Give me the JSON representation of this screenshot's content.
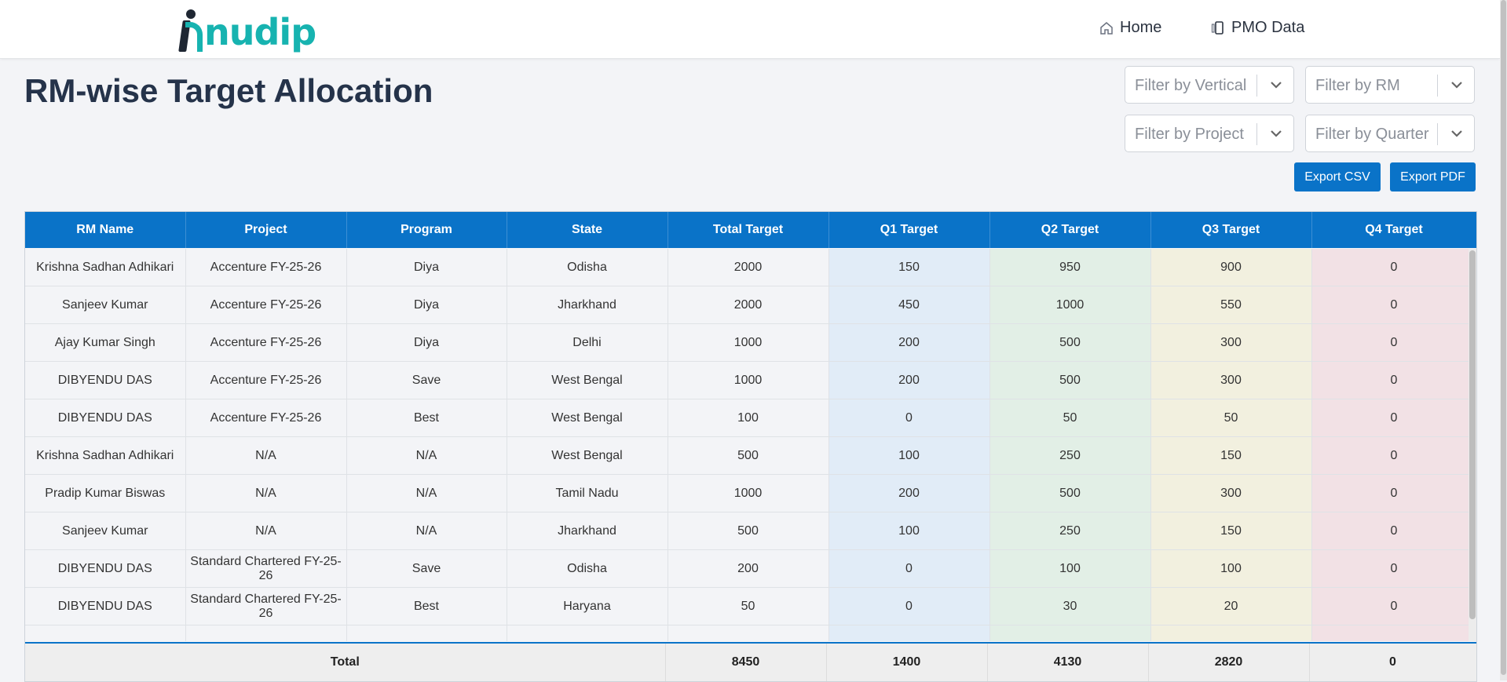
{
  "brand": {
    "logo_text": "nudip",
    "logo_full": "Anudip",
    "accent": "#17b3b0",
    "dark": "#1f2733"
  },
  "nav": {
    "home": "Home",
    "pmo": "PMO Data"
  },
  "page": {
    "title": "RM-wise Target Allocation"
  },
  "filters": {
    "vertical": "Filter by Vertical",
    "rm": "Filter by RM",
    "project": "Filter by Project",
    "quarter": "Filter by Quarter"
  },
  "actions": {
    "export_csv": "Export CSV",
    "export_pdf": "Export PDF"
  },
  "colors": {
    "primary": "#0a73c8",
    "q1": "#e1ecf7",
    "q2": "#e2efe6",
    "q3": "#f2f0df",
    "q4": "#f2e1e5"
  },
  "table": {
    "columns": [
      "RM Name",
      "Project",
      "Program",
      "State",
      "Total Target",
      "Q1 Target",
      "Q2 Target",
      "Q3 Target",
      "Q4 Target"
    ],
    "rows": [
      [
        "Krishna Sadhan Adhikari",
        "Accenture FY-25-26",
        "Diya",
        "Odisha",
        "2000",
        "150",
        "950",
        "900",
        "0"
      ],
      [
        "Sanjeev Kumar",
        "Accenture FY-25-26",
        "Diya",
        "Jharkhand",
        "2000",
        "450",
        "1000",
        "550",
        "0"
      ],
      [
        "Ajay Kumar Singh",
        "Accenture FY-25-26",
        "Diya",
        "Delhi",
        "1000",
        "200",
        "500",
        "300",
        "0"
      ],
      [
        "DIBYENDU DAS",
        "Accenture FY-25-26",
        "Save",
        "West Bengal",
        "1000",
        "200",
        "500",
        "300",
        "0"
      ],
      [
        "DIBYENDU DAS",
        "Accenture FY-25-26",
        "Best",
        "West Bengal",
        "100",
        "0",
        "50",
        "50",
        "0"
      ],
      [
        "Krishna Sadhan Adhikari",
        "N/A",
        "N/A",
        "West Bengal",
        "500",
        "100",
        "250",
        "150",
        "0"
      ],
      [
        "Pradip Kumar Biswas",
        "N/A",
        "N/A",
        "Tamil Nadu",
        "1000",
        "200",
        "500",
        "300",
        "0"
      ],
      [
        "Sanjeev Kumar",
        "N/A",
        "N/A",
        "Jharkhand",
        "500",
        "100",
        "250",
        "150",
        "0"
      ],
      [
        "DIBYENDU DAS",
        "Standard Chartered FY-25-26",
        "Save",
        "Odisha",
        "200",
        "0",
        "100",
        "100",
        "0"
      ],
      [
        "DIBYENDU DAS",
        "Standard Chartered FY-25-26",
        "Best",
        "Haryana",
        "50",
        "0",
        "30",
        "20",
        "0"
      ],
      [
        "",
        "",
        "",
        "",
        "",
        "",
        "",
        "",
        ""
      ]
    ],
    "totals": {
      "label": "Total",
      "total": "8450",
      "q1": "1400",
      "q2": "4130",
      "q3": "2820",
      "q4": "0"
    }
  }
}
